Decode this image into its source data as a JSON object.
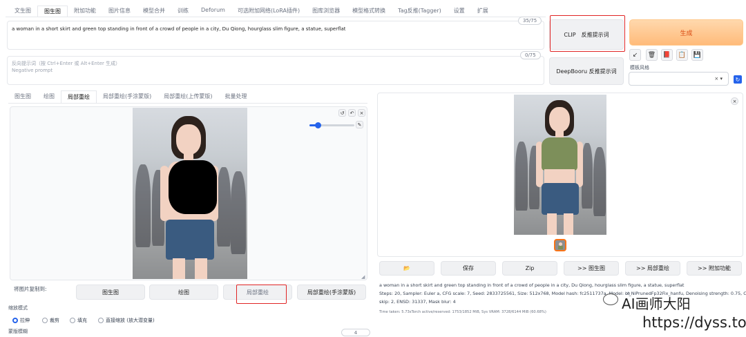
{
  "top_tabs": [
    "文生图",
    "图生图",
    "附加功能",
    "图片信息",
    "模型合并",
    "训练",
    "Deforum",
    "可选附加网络(LoRA插件)",
    "图库浏览器",
    "模型格式转换",
    "Tag反推(Tagger)",
    "设置",
    "扩展"
  ],
  "prompt": {
    "text": "a woman in a short skirt and green top standing in front of a crowd of people in a city, Du Qiong, hourglass slim figure, a statue, superflat",
    "counter": "35/75"
  },
  "negative": {
    "label": "反向提示词（按 Ctrl+Enter 或 Alt+Enter 生成）",
    "placeholder": "Negative prompt",
    "counter": "0/75"
  },
  "buttons": {
    "clip": "CLIP　反推提示词",
    "deepbooru": "DeepBooru 反推提示词",
    "generate": "生成"
  },
  "tools": [
    "↙",
    "🗑",
    "📕",
    "📋",
    "💾"
  ],
  "style": {
    "label": "模板风格",
    "clear": "× ▾",
    "apply": "↻"
  },
  "sub_tabs": [
    "图生图",
    "绘图",
    "局部重绘",
    "局部重绘(手涂蒙版)",
    "局部重绘(上传蒙版)",
    "批量处理"
  ],
  "canvas_controls": [
    "↺",
    "↶",
    "×"
  ],
  "copy_to": {
    "label": "将图片复制到:",
    "buttons": [
      "图生图",
      "绘图",
      "局部重绘",
      "局部重绘(手涂蒙版)"
    ]
  },
  "resize_mode": {
    "label": "缩放模式",
    "options": [
      "拉伸",
      "裁剪",
      "填充",
      "直接缩放 (放大潜变量)"
    ],
    "selected": 0
  },
  "mask_blur": {
    "label": "蒙版模糊",
    "value": "4"
  },
  "output_buttons": [
    "📂",
    "保存",
    "Zip",
    ">> 图生图",
    ">> 局部重绘",
    ">> 附加功能"
  ],
  "output_info": {
    "prompt": "a woman in a short skirt and green top standing in front of a crowd of people in a city, Du Qiong, hourglass slim figure, a statue, superflat",
    "params_line1": "Steps: 20, Sampler: Euler a, CFG scale: 7, Seed: 2833725561, Size: 512x768, Model hash: fc2511737a, Model: ch",
    "params_line1b": "ix_NiPrunedFp32Fix_hanfu, Denoising strength: 0.75, Clip",
    "params_line2": "skip: 2, ENSD: 31337, Mask blur: 4",
    "timing": "Time taken: 5.73sTorch active/reserved: 1753/1852 MiB, Sys VRAM: 3728/6144 MiB (60.68%)"
  },
  "watermark": {
    "account": "AI画师大阳",
    "url": "https://dyss.top"
  }
}
